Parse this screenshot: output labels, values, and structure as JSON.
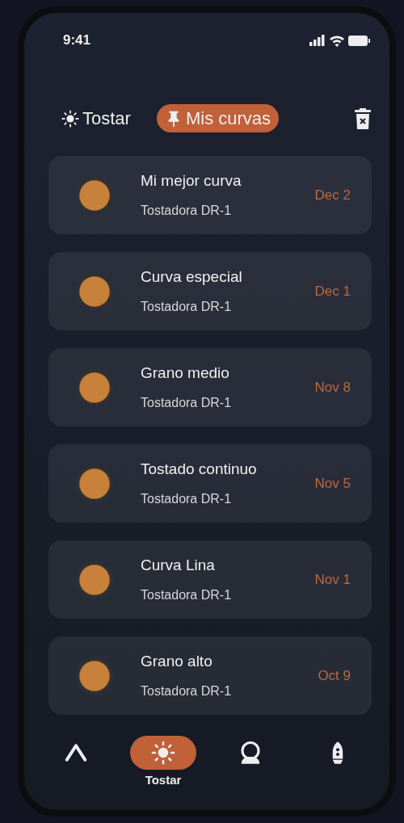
{
  "status_bar": {
    "time": "9:41"
  },
  "tabs": [
    {
      "label": "Tostar",
      "kind": "sun",
      "selected": false
    },
    {
      "label": "Mis curvas",
      "kind": "pin",
      "selected": true
    }
  ],
  "curves": [
    {
      "title": "Mi mejor curva",
      "subtitle": "Tostadora DR-1",
      "date": "Dec 2"
    },
    {
      "title": "Curva especial",
      "subtitle": "Tostadora DR-1",
      "date": "Dec 1"
    },
    {
      "title": "Grano medio",
      "subtitle": "Tostadora DR-1",
      "date": "Nov 8"
    },
    {
      "title": "Tostado continuo",
      "subtitle": "Tostadora DR-1",
      "date": "Nov 5"
    },
    {
      "title": "Curva Lina",
      "subtitle": "Tostadora DR-1",
      "date": "Nov 1"
    },
    {
      "title": "Grano alto",
      "subtitle": "Tostadora DR-1",
      "date": "Oct 9"
    }
  ],
  "bottom_nav": [
    {
      "kind": "chevron",
      "selected": false
    },
    {
      "kind": "sun",
      "label": "Tostar",
      "selected": true
    },
    {
      "kind": "helmet",
      "selected": false
    },
    {
      "kind": "rocket",
      "selected": false
    }
  ]
}
